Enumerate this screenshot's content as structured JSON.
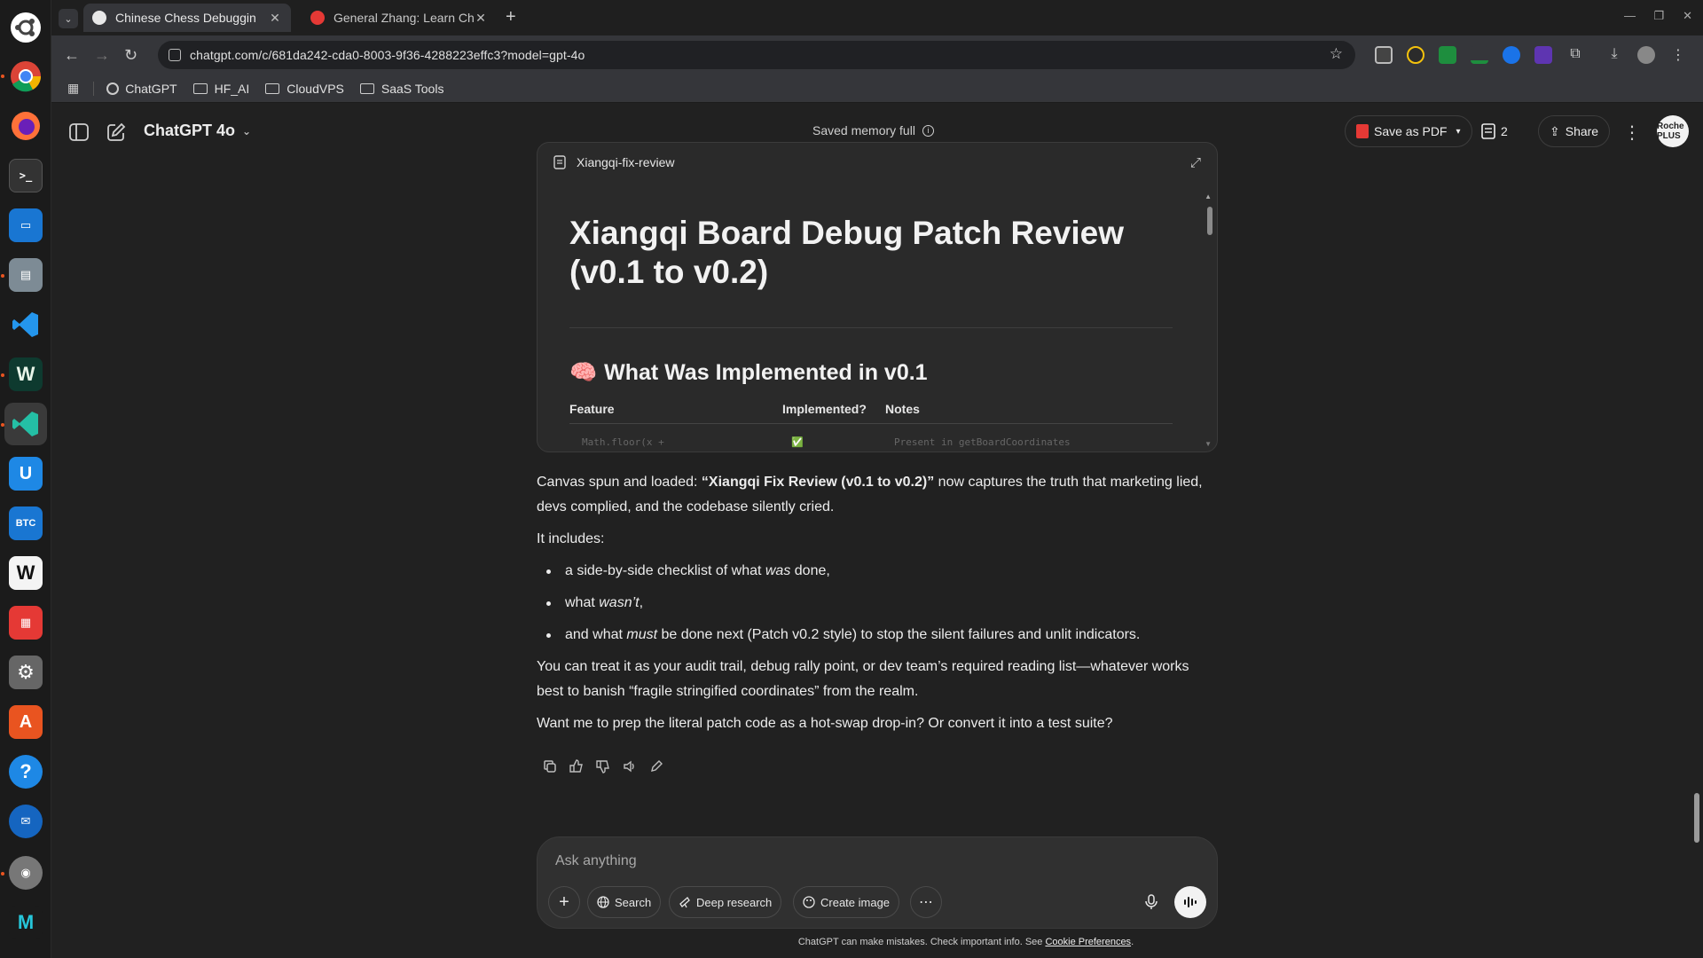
{
  "browser": {
    "tabs": [
      {
        "title": "Chinese Chess Debuggin",
        "active": true
      },
      {
        "title": "General Zhang: Learn Ch",
        "active": false
      }
    ],
    "url": "chatgpt.com/c/681da242-cda0-8003-9f36-4288223effc3?model=gpt-4o",
    "bookmarks": [
      "ChatGPT",
      "HF_AI",
      "CloudVPS",
      "SaaS Tools"
    ]
  },
  "header": {
    "model": "ChatGPT 4o",
    "memory": "Saved memory full",
    "save_pdf": "Save as PDF",
    "doc_count": "2",
    "share": "Share",
    "avatar_text": "Roche PLUS"
  },
  "canvas": {
    "name": "Xiangqi-fix-review",
    "title": "Xiangqi Board Debug Patch Review (v0.1 to v0.2)",
    "section_emoji": "🧠",
    "section": "What Was Implemented in v0.1",
    "columns": [
      "Feature",
      "Implemented?",
      "Notes"
    ],
    "rows": [
      [
        "Math.floor(x +",
        "✅",
        "Present in getBoardCoordinates"
      ]
    ]
  },
  "message": {
    "p1_pre": "Canvas spun and loaded: ",
    "p1_bold": "“Xiangqi Fix Review (v0.1 to v0.2)”",
    "p1_post": " now captures the truth that marketing lied, devs complied, and the codebase silently cried.",
    "p2": "It includes:",
    "b1_pre": "a side-by-side checklist of what ",
    "b1_em": "was",
    "b1_post": " done,",
    "b2_pre": "what ",
    "b2_em": "wasn’t",
    "b2_post": ",",
    "b3_pre": "and what ",
    "b3_em": "must",
    "b3_post": " be done next (Patch v0.2 style) to stop the silent failures and unlit indicators.",
    "p3": "You can treat it as your audit trail, debug rally point, or dev team’s required reading list—whatever works best to banish “fragile stringified coordinates” from the realm.",
    "p4": "Want me to prep the literal patch code as a hot-swap drop-in? Or convert it into a test suite?"
  },
  "composer": {
    "placeholder": "Ask anything",
    "search": "Search",
    "deep_research": "Deep research",
    "create_image": "Create image"
  },
  "footer": {
    "text": "ChatGPT can make mistakes. Check important info. See ",
    "link": "Cookie Preferences",
    "end": "."
  },
  "colors": {
    "accent": "#e95420",
    "bg": "#212121",
    "card": "#2a2a2a"
  }
}
